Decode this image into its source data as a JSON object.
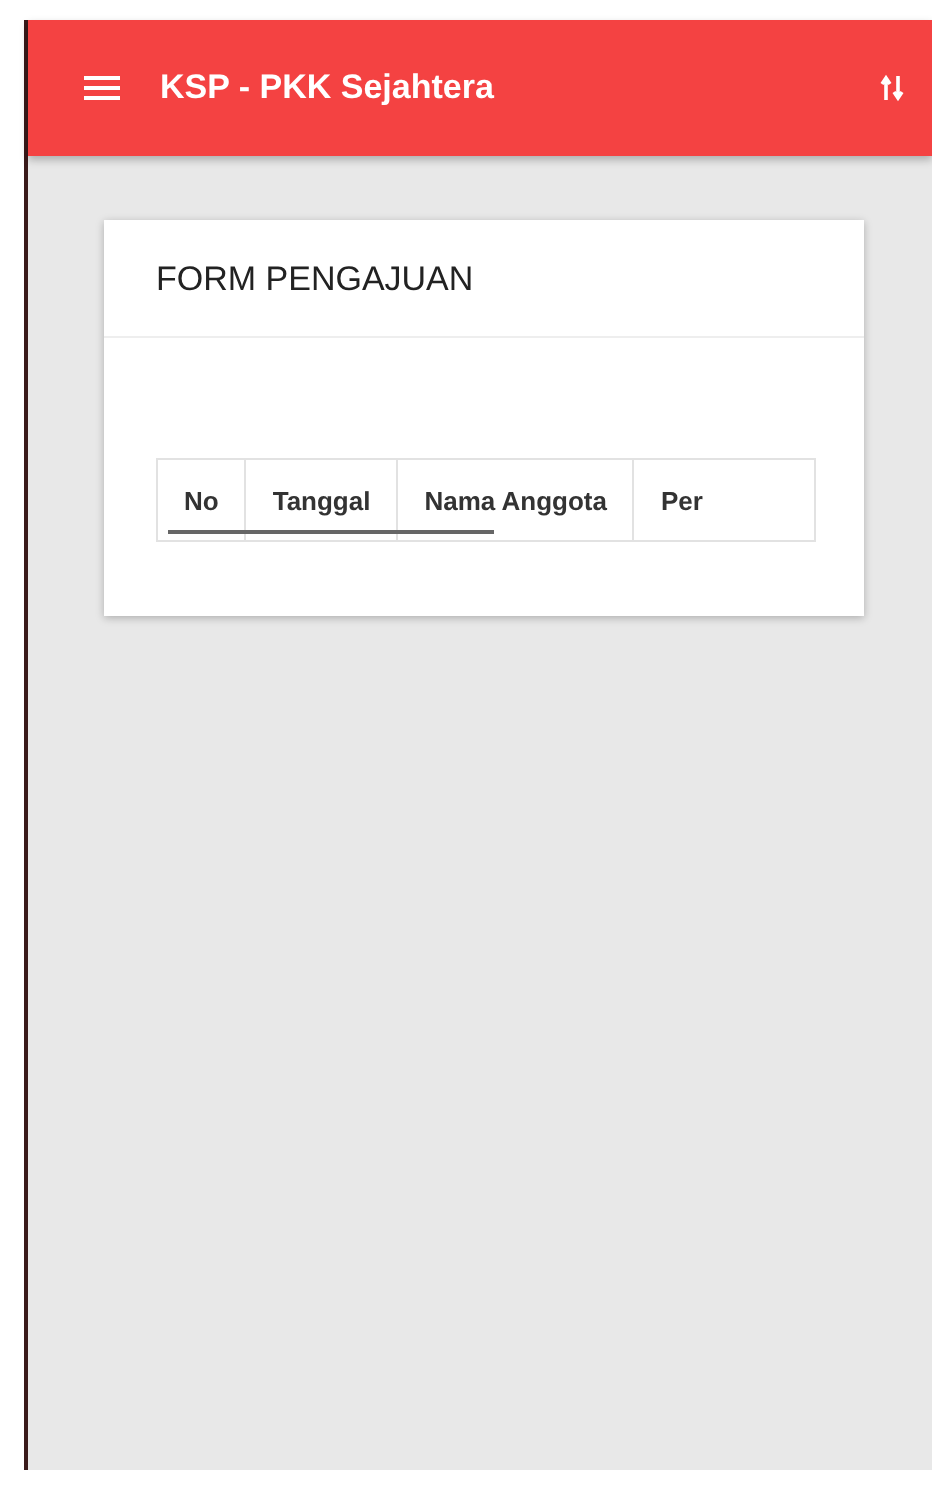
{
  "app_bar": {
    "title": "KSP - PKK Sejahtera"
  },
  "card": {
    "title": "FORM PENGAJUAN",
    "table": {
      "columns": [
        "No",
        "Tanggal",
        "Nama Anggota",
        "Per"
      ]
    }
  }
}
